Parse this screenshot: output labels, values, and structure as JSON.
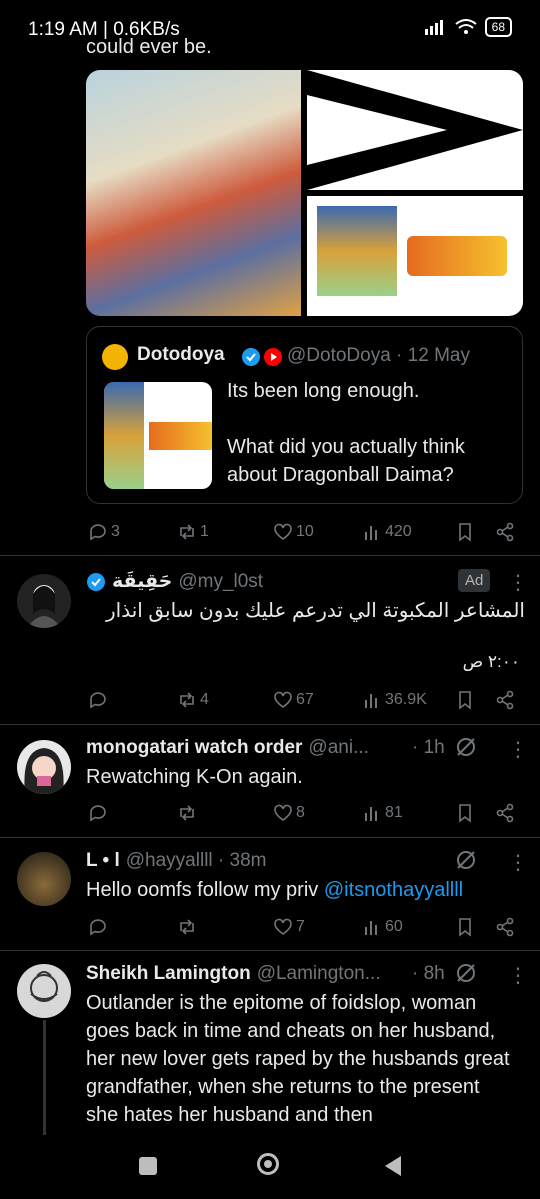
{
  "status": {
    "time": "1:19 AM | 0.6KB/s",
    "battery": "68"
  },
  "tweet0": {
    "cut_text": "could ever be.",
    "quote": {
      "name": "Dotodoya",
      "handle": "@DotoDoya · 12 May",
      "text": "Its been long enough.\n\nWhat did you actually think about Dragonball Daima?"
    },
    "actions": {
      "replies": "3",
      "retweets": "1",
      "likes": "10",
      "views": "420"
    }
  },
  "tweet1": {
    "name": "حَقِيقَة",
    "handle": "@my_l0st",
    "ad": "Ad",
    "text": "المشاعر المكبوتة الي تدرعم عليك بدون سابق انذار",
    "time": "٢:٠٠ ص",
    "actions": {
      "retweets": "4",
      "likes": "67",
      "views": "36.9K"
    }
  },
  "tweet2": {
    "name": "monogatari watch order",
    "handle": "@ani...",
    "time": "· 1h",
    "text": "Rewatching K-On again.",
    "actions": {
      "likes": "8",
      "views": "81"
    }
  },
  "tweet3": {
    "name": "L • l",
    "handle": "@hayyallll · 38m",
    "text": "Hello oomfs follow my priv ",
    "link": "@itsnothayyallll",
    "actions": {
      "likes": "7",
      "views": "60"
    }
  },
  "tweet4": {
    "name": "Sheikh Lamington",
    "handle": "@Lamington...",
    "time": "· 8h",
    "text": "Outlander is the epitome of foidslop, woman goes back in time and cheats on her husband, her new lover gets raped by the husbands great grandfather, when she returns to the present she hates her husband and then"
  },
  "colors": {
    "accent": "#1d9bf0",
    "muted": "#71767b",
    "divider": "#2f3336"
  }
}
